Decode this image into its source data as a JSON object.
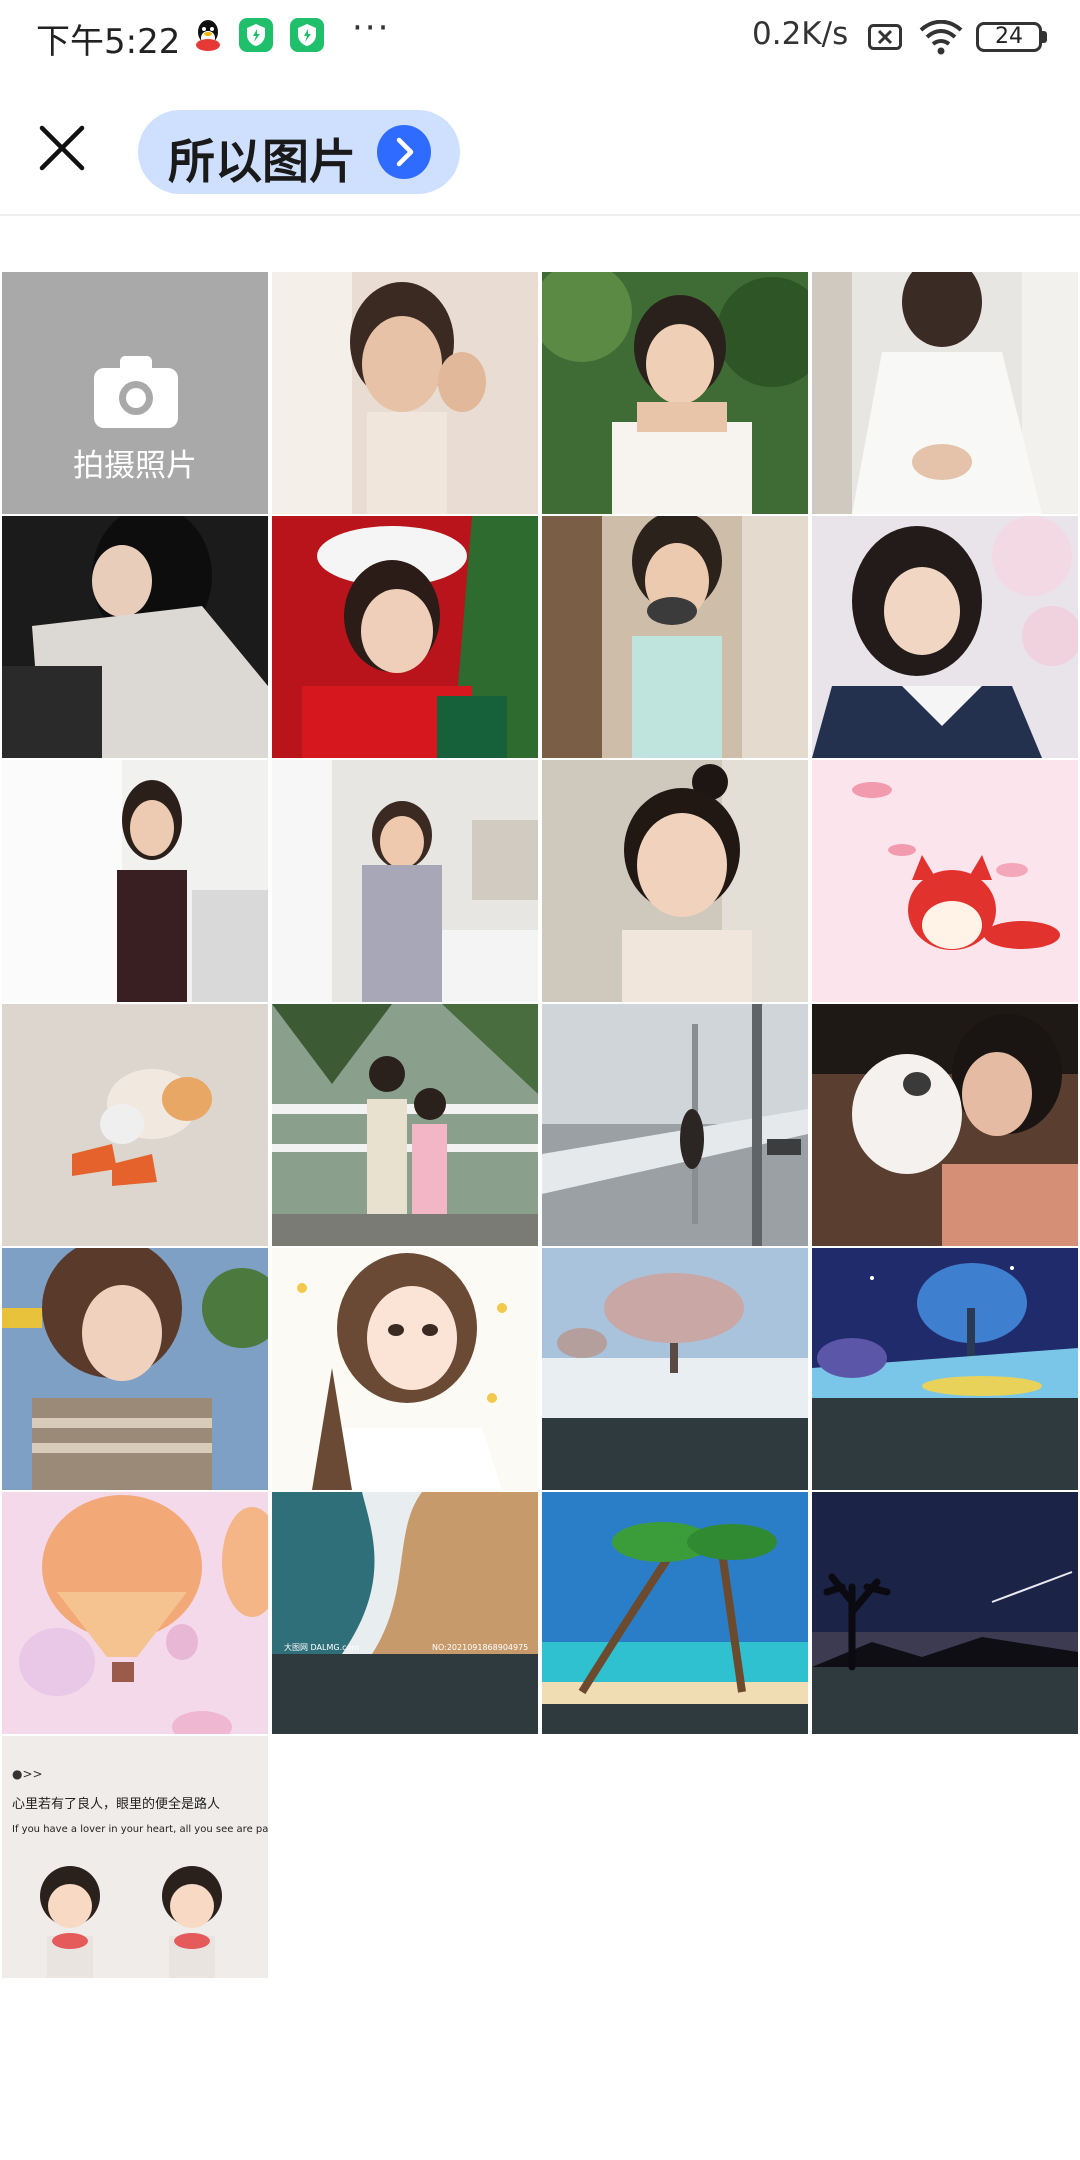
{
  "status_bar": {
    "time": "下午5:22",
    "dots": "···",
    "net_speed": "0.2K/s",
    "battery": "24",
    "icons": [
      "qq-icon",
      "shield-icon",
      "shield-icon",
      "sim-off-icon",
      "wifi-icon",
      "battery-icon"
    ]
  },
  "header": {
    "album_label": "所以图片",
    "icons": [
      "close-icon",
      "chevron-right-icon"
    ]
  },
  "grid": {
    "camera_label": "拍摄照片",
    "photos": [
      {
        "subject": "portrait"
      },
      {
        "subject": "portrait-garden"
      },
      {
        "subject": "portrait-white-dress"
      },
      {
        "subject": "portrait-dark"
      },
      {
        "subject": "christmas-portrait"
      },
      {
        "subject": "portrait-window"
      },
      {
        "subject": "portrait-blossom"
      },
      {
        "subject": "portrait-curtain"
      },
      {
        "subject": "portrait-room"
      },
      {
        "subject": "portrait-bun"
      },
      {
        "subject": "cartoon-fox"
      },
      {
        "subject": "cartoon-cat-shoes"
      },
      {
        "subject": "kids-palms"
      },
      {
        "subject": "bridge-walk"
      },
      {
        "subject": "girl-with-cat"
      },
      {
        "subject": "portrait-wind"
      },
      {
        "subject": "illustrated-girl"
      },
      {
        "subject": "snow-tree"
      },
      {
        "subject": "fantasy-tree"
      },
      {
        "subject": "hot-air-balloons"
      },
      {
        "subject": "beach-waves"
      },
      {
        "subject": "palm-beach"
      },
      {
        "subject": "night-sky-tree"
      },
      {
        "subject": "quote-card"
      }
    ],
    "beach_caption_left": "大图网 DALMG.com",
    "beach_caption_right": "NO:20210918689049​75",
    "quote_title": "心里若有了良人，眼里的便全是路人",
    "quote_en": "If you have a lover in your heart, all you see are passers-by.",
    "quote_tag": "●>>",
    "colors": {
      "accent_blue": "#2f6bff",
      "pill_bg": "#cfe0ff",
      "camera_bg": "#a9a9a9"
    }
  }
}
